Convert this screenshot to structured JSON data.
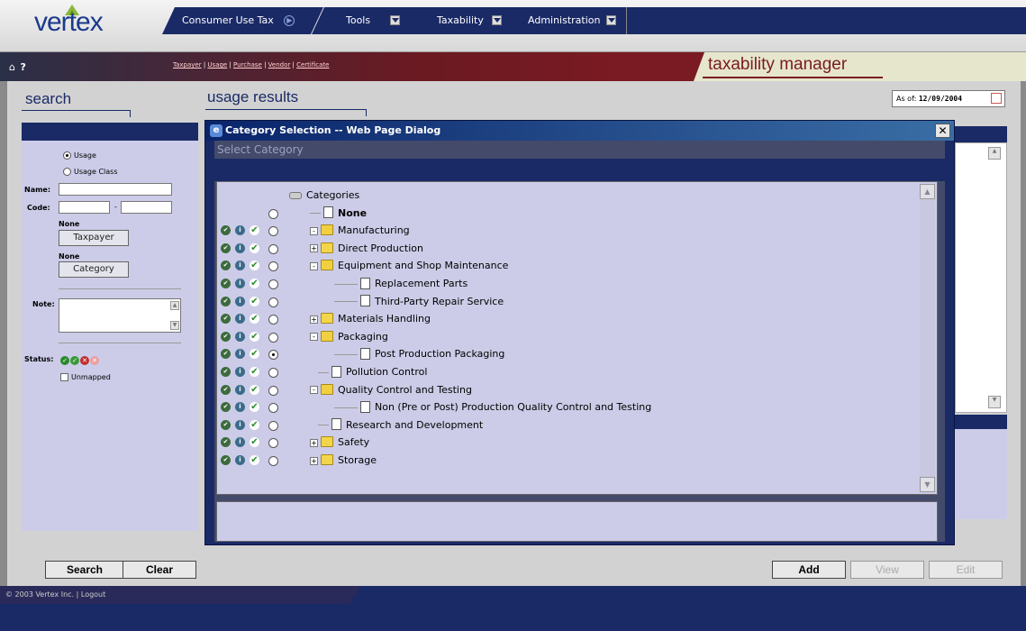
{
  "logo": {
    "text": "vertex"
  },
  "topnav": {
    "items": [
      {
        "label": "Consumer Use Tax"
      },
      {
        "label": "Tools"
      },
      {
        "label": "Taxability"
      },
      {
        "label": "Administration"
      }
    ]
  },
  "subnav": {
    "links": [
      "Taxpayer",
      "Usage",
      "Purchase",
      "Vendor",
      "Certificate"
    ],
    "separator": " | "
  },
  "app_title": "taxability manager",
  "search": {
    "heading": "search",
    "radio_usage": "Usage",
    "radio_usage_class": "Usage Class",
    "name_label": "Name:",
    "code_label": "Code:",
    "code_dash": "-",
    "taxpayer_none": "None",
    "taxpayer_button": "Taxpayer",
    "category_none": "None",
    "category_button": "Category",
    "note_label": "Note:",
    "status_label": "Status:",
    "unmapped_label": "Unmapped",
    "search_button": "Search",
    "clear_button": "Clear"
  },
  "results": {
    "heading": "usage results",
    "as_of_label": "As of:",
    "as_of_value": "12/09/2004",
    "add_button": "Add",
    "view_button": "View",
    "edit_button": "Edit"
  },
  "dialog": {
    "title": "Category Selection -- Web Page Dialog",
    "close": "✕",
    "subtitle": "Select Category",
    "tree": [
      {
        "label": "Categories",
        "level": 0,
        "icon": "drive-icon",
        "actions": false,
        "radio": false
      },
      {
        "label": "None",
        "level": 1,
        "icon": "document-icon",
        "actions": false,
        "radio": true,
        "bold": true
      },
      {
        "label": "Manufacturing",
        "level": 1,
        "icon": "folder-open-icon",
        "actions": true,
        "radio": true,
        "expander": "-"
      },
      {
        "label": "Direct Production",
        "level": 2,
        "icon": "folder-icon",
        "actions": true,
        "radio": true,
        "expander": "+"
      },
      {
        "label": "Equipment and Shop Maintenance",
        "level": 2,
        "icon": "folder-open-icon",
        "actions": true,
        "radio": true,
        "expander": "-"
      },
      {
        "label": "Replacement Parts",
        "level": 3,
        "icon": "document-icon",
        "actions": true,
        "radio": true
      },
      {
        "label": "Third-Party Repair Service",
        "level": 3,
        "icon": "document-icon",
        "actions": true,
        "radio": true
      },
      {
        "label": "Materials Handling",
        "level": 2,
        "icon": "folder-icon",
        "actions": true,
        "radio": true,
        "expander": "+"
      },
      {
        "label": "Packaging",
        "level": 2,
        "icon": "folder-open-icon",
        "actions": true,
        "radio": true,
        "expander": "-"
      },
      {
        "label": "Post Production Packaging",
        "level": 3,
        "icon": "document-icon",
        "actions": true,
        "radio": true,
        "selected": true
      },
      {
        "label": "Pollution Control",
        "level": 2,
        "icon": "document-icon",
        "actions": true,
        "radio": true
      },
      {
        "label": "Quality Control and Testing",
        "level": 2,
        "icon": "folder-open-icon",
        "actions": true,
        "radio": true,
        "expander": "-"
      },
      {
        "label": "Non (Pre or Post) Production Quality Control and Testing",
        "level": 3,
        "icon": "document-icon",
        "actions": true,
        "radio": true
      },
      {
        "label": "Research and Development",
        "level": 2,
        "icon": "document-icon",
        "actions": true,
        "radio": true
      },
      {
        "label": "Safety",
        "level": 2,
        "icon": "folder-icon",
        "actions": true,
        "radio": true,
        "expander": "+"
      },
      {
        "label": "Storage",
        "level": 2,
        "icon": "folder-icon",
        "actions": true,
        "radio": true,
        "expander": "+"
      }
    ]
  },
  "footer": {
    "copyright": "© 2003 Vertex Inc.",
    "separator": "|",
    "logout": "Logout"
  },
  "colors": {
    "navy": "#1a2a66",
    "maroon": "#7a1a22",
    "lavender": "#cccce8"
  }
}
